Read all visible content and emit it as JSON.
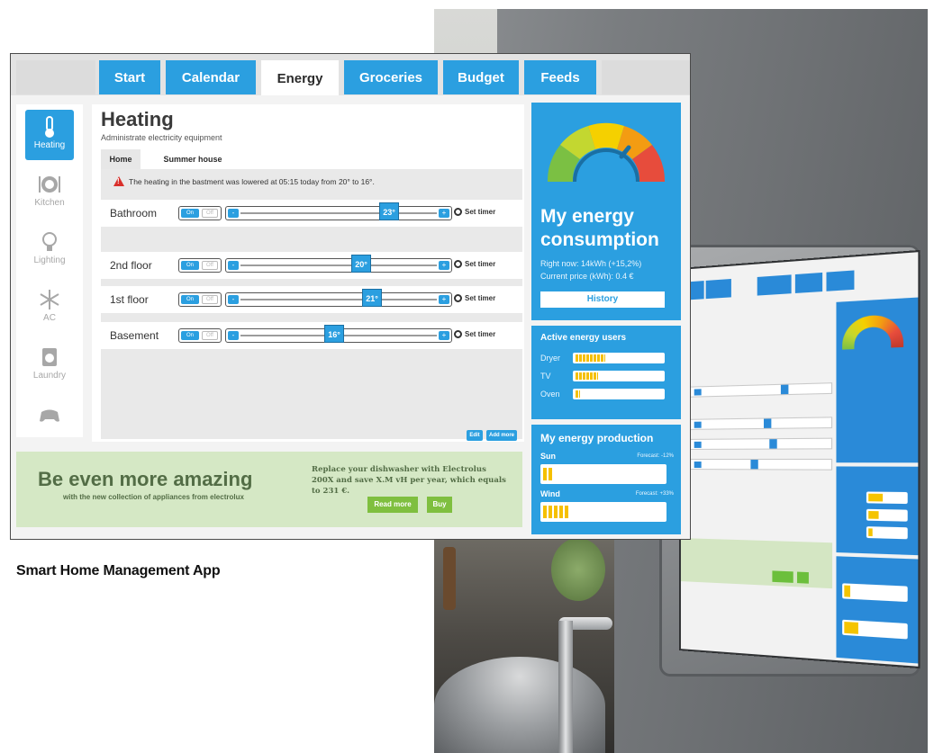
{
  "tabs": [
    "Start",
    "Calendar",
    "Energy",
    "Groceries",
    "Budget",
    "Feeds"
  ],
  "active_tab": "Energy",
  "sidebar": [
    {
      "label": "Heating",
      "icon": "thermometer-icon",
      "active": true
    },
    {
      "label": "Kitchen",
      "icon": "plate-icon",
      "active": false
    },
    {
      "label": "Lighting",
      "icon": "lightbulb-icon",
      "active": false
    },
    {
      "label": "AC",
      "icon": "snowflake-icon",
      "active": false
    },
    {
      "label": "Laundry",
      "icon": "washing-machine-icon",
      "active": false
    },
    {
      "label": "",
      "icon": "gamepad-icon",
      "active": false
    }
  ],
  "heating": {
    "title": "Heating",
    "subtitle": "Administrate electricity equipment",
    "subtabs": [
      "Home",
      "Summer house"
    ],
    "alert": "The heating in the bastment was lowered at 05:15 today from 20° to 16°.",
    "rooms": [
      {
        "name": "Bathroom",
        "temp": "23°",
        "level": 0.78
      },
      {
        "name": "2nd floor",
        "temp": "20°",
        "level": 0.62
      },
      {
        "name": "1st floor",
        "temp": "21°",
        "level": 0.68
      },
      {
        "name": "Basement",
        "temp": "16°",
        "level": 0.47
      }
    ],
    "on_label": "On",
    "off_label": "Off",
    "minus_label": "-",
    "plus_label": "+",
    "timer_label": "Set timer",
    "edit_label": "Edit",
    "add_label": "Add more"
  },
  "consumption": {
    "title_line1": "My energy",
    "title_line2": "consumption",
    "right_now": "Right now: 14kWh (+15,2%)",
    "price": "Current price (kWh): 0.4 €",
    "history_label": "History"
  },
  "active_users": {
    "title": "Active energy users",
    "items": [
      {
        "label": "Dryer",
        "level": 0.34
      },
      {
        "label": "TV",
        "level": 0.26
      },
      {
        "label": "Oven",
        "level": 0.05
      }
    ]
  },
  "production": {
    "title": "My energy production",
    "items": [
      {
        "label": "Sun",
        "forecast": "Forecast: -12%",
        "level": 0.08
      },
      {
        "label": "Wind",
        "forecast": "Forecast: +33%",
        "level": 0.22
      }
    ]
  },
  "ad": {
    "headline": "Be even more amazing",
    "tagline": "with the new collection of appliances from electrolux",
    "copy": "Replace your dishwasher with Electrolus 200X and save X.M vH per year, which equals to 231 €.",
    "read_more": "Read more",
    "buy": "Buy"
  },
  "caption": "Smart Home Management App",
  "colors": {
    "accent": "#2b9fe0",
    "ad_bg": "#d5e8c5",
    "ad_text": "#536d46",
    "bar_fill": "#f5c000"
  }
}
